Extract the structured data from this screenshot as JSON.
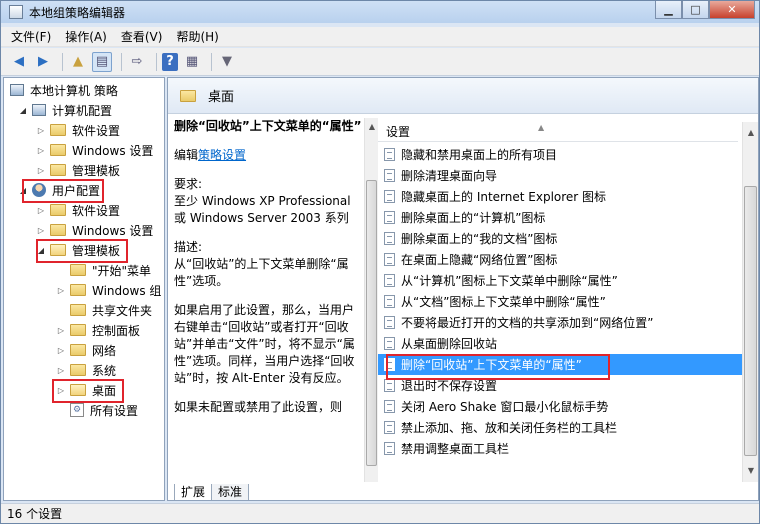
{
  "window": {
    "title": "本地组策略编辑器"
  },
  "menu": [
    "文件(F)",
    "操作(A)",
    "查看(V)",
    "帮助(H)"
  ],
  "tree": {
    "root": "本地计算机 策略",
    "computer_config": "计算机配置",
    "cc_children": [
      "软件设置",
      "Windows 设置",
      "管理模板"
    ],
    "user_config": "用户配置",
    "uc_children": [
      "软件设置",
      "Windows 设置",
      "管理模板"
    ],
    "admin_children": [
      "\"开始\"菜单",
      "Windows 组",
      "共享文件夹",
      "控制面板",
      "网络",
      "系统",
      "桌面",
      "所有设置"
    ]
  },
  "right": {
    "header": "桌面",
    "desc_title": "删除“回收站”上下文菜单的“属性”",
    "edit_prefix": "编辑",
    "edit_link": "策略设置",
    "req_label": "要求:",
    "req_text": "至少 Windows XP Professional 或 Windows Server 2003 系列",
    "desc_label": "描述:",
    "desc_text": "从“回收站”的上下文菜单删除“属性”选项。",
    "desc_more": "如果启用了此设置，那么，当用户右键单击“回收站”或者打开“回收站”并单击“文件”时，将不显示“属性”选项。同样，当用户选择“回收站”时，按 Alt-Enter 没有反应。",
    "desc_more2": "如果未配置或禁用了此设置，则",
    "list_header": "设置",
    "items": [
      "隐藏和禁用桌面上的所有项目",
      "删除清理桌面向导",
      "隐藏桌面上的 Internet Explorer 图标",
      "删除桌面上的“计算机”图标",
      "删除桌面上的“我的文档”图标",
      "在桌面上隐藏“网络位置”图标",
      "从“计算机”图标上下文菜单中删除“属性”",
      "从“文档”图标上下文菜单中删除“属性”",
      "不要将最近打开的文档的共享添加到“网络位置”",
      "从桌面删除回收站",
      "删除“回收站”上下文菜单的“属性”",
      "退出时不保存设置",
      "关闭 Aero Shake 窗口最小化鼠标手势",
      "禁止添加、拖、放和关闭任务栏的工具栏",
      "禁用调整桌面工具栏"
    ],
    "selected_index": 10,
    "tabs": [
      "扩展",
      "标准"
    ]
  },
  "status": "16 个设置",
  "colors": {
    "selection": "#3399ff",
    "highlight_box": "#e0242c",
    "link": "#0066cc"
  }
}
